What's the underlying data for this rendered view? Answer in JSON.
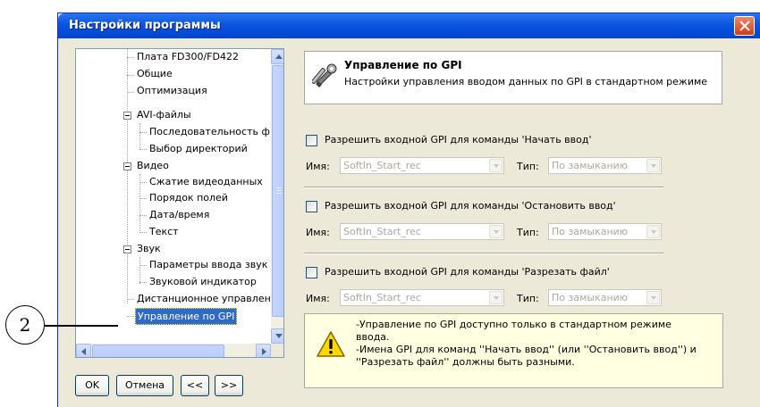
{
  "window": {
    "title": "Настройки программы"
  },
  "tree": {
    "items": [
      {
        "label": "Плата FD300/FD422"
      },
      {
        "label": "Общие"
      },
      {
        "label": "Оптимизация"
      },
      {
        "label": "AVI-файлы"
      },
      {
        "label": "Последовательность ф"
      },
      {
        "label": "Выбор директорий"
      },
      {
        "label": "Видео"
      },
      {
        "label": "Сжатие видеоданных"
      },
      {
        "label": "Порядок полей"
      },
      {
        "label": "Дата/время"
      },
      {
        "label": "Текст"
      },
      {
        "label": "Звук"
      },
      {
        "label": "Параметры ввода звук"
      },
      {
        "label": "Звуковой индикатор"
      },
      {
        "label": "Дистанционное управлени"
      },
      {
        "label": "Управление по GPI"
      }
    ]
  },
  "buttons": {
    "ok": "OK",
    "cancel": "Отмена",
    "prev": "<<",
    "next": ">>"
  },
  "header": {
    "title": "Управление по GPI",
    "subtitle": "Настройки управления вводом данных по GPI в стандартном режиме",
    "icon": "tools-icon"
  },
  "gpi": [
    {
      "checkbox_label": "Разрешить входной GPI для команды 'Начать ввод'",
      "name_label": "Имя:",
      "name_value": "SoftIn_Start_rec",
      "type_label": "Тип:",
      "type_value": "По замыканию",
      "checked": false
    },
    {
      "checkbox_label": "Разрешить входной GPI для команды 'Остановить ввод'",
      "name_label": "Имя:",
      "name_value": "SoftIn_Start_rec",
      "type_label": "Тип:",
      "type_value": "По замыканию",
      "checked": false
    },
    {
      "checkbox_label": "Разрешить входной GPI для команды 'Разрезать файл'",
      "name_label": "Имя:",
      "name_value": "SoftIn_Start_rec",
      "type_label": "Тип:",
      "type_value": "По замыканию",
      "checked": false
    }
  ],
  "info": {
    "icon": "warning-icon",
    "text": "-Управление по GPI доступно только в стандартном режиме\nввода.\n-Имена GPI для команд ''Начать ввод'' (или ''Остановить ввод'') и\n''Разрезать файл'' должны быть разными."
  },
  "callout": {
    "number": "2"
  },
  "colors": {
    "titlebar": "#0a54e0",
    "selection": "#316ac5",
    "info_bg": "#ffffe1"
  }
}
